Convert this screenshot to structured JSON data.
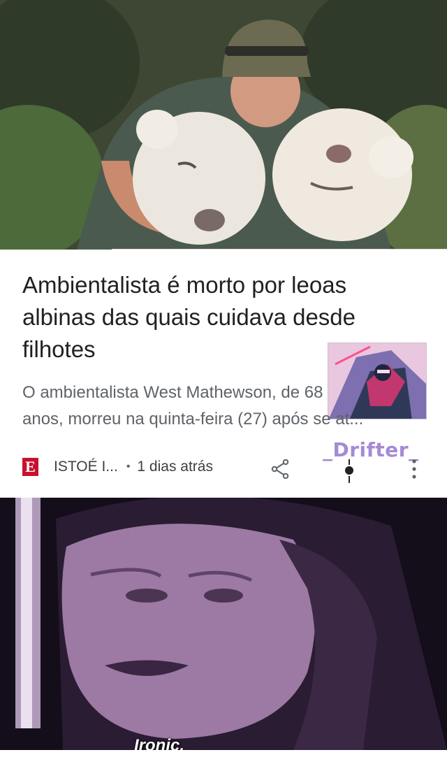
{
  "article": {
    "headline": "Ambientalista é morto por leoas albinas das quais cuidava desde filhotes",
    "snippet_line1": "O ambientalista West Mathewson, de 68",
    "snippet_line2": "anos, morreu na quinta-feira (27) após se at...",
    "source_logo_letter": "E",
    "source_name": "ISTOÉ I...",
    "separator": "•",
    "time": "1 dias atrás",
    "share_icon": "share-icon",
    "more_icon": "more-vert-icon"
  },
  "watermark": {
    "text": "_Drifter_",
    "color": "#a58ad6"
  },
  "meme": {
    "caption": "Ironic."
  },
  "colors": {
    "source_logo": "#c8102e",
    "headline": "#202124",
    "snippet": "#5f6368"
  }
}
